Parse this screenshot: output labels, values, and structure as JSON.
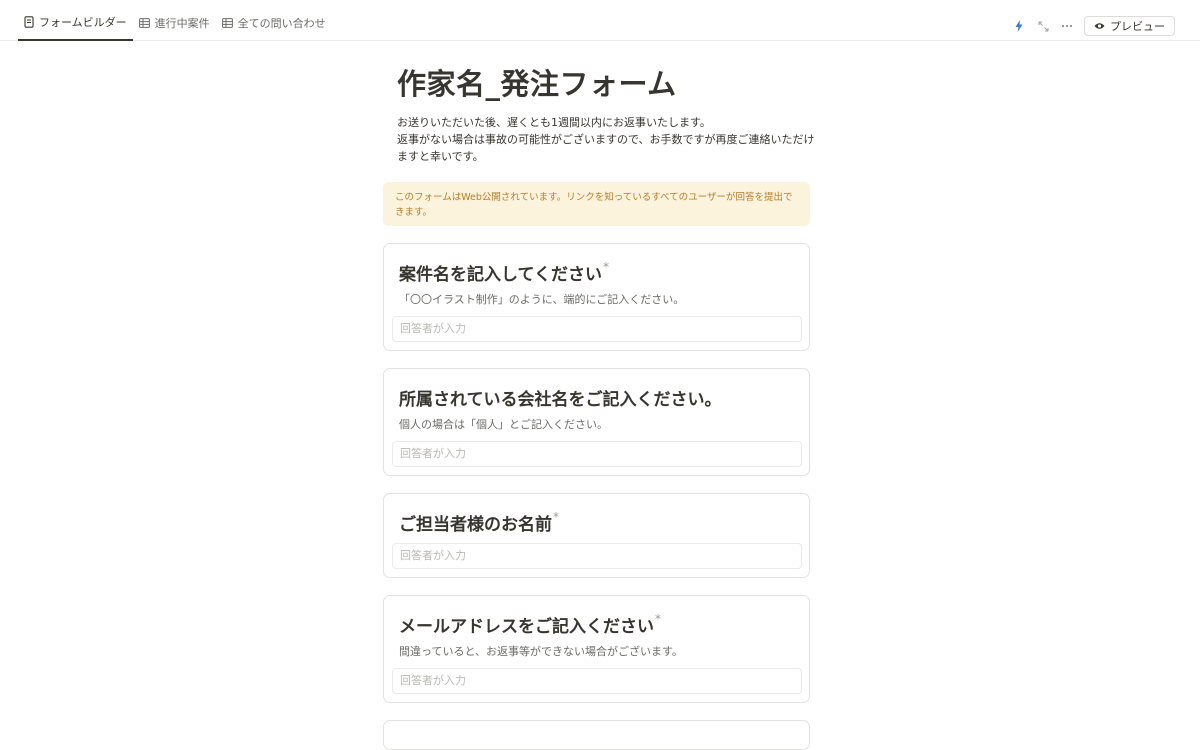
{
  "tabs": [
    {
      "label": "フォームビルダー",
      "active": true
    },
    {
      "label": "進行中案件",
      "active": false
    },
    {
      "label": "全ての問い合わせ",
      "active": false
    }
  ],
  "toolbar": {
    "preview_label": "プレビュー",
    "icons": [
      "lightning-icon",
      "expand-icon",
      "more-icon",
      "eye-icon"
    ]
  },
  "form": {
    "title": "作家名_発注フォーム",
    "description_lines": [
      "お送りいただいた後、遅くとも1週間以内にお返事いたします。",
      "返事がない場合は事故の可能性がございますので、お手数ですが再度ご連絡いただけますと幸いです。"
    ],
    "notice": "このフォームはWeb公開されています。リンクを知っているすべてのユーザーが回答を提出できます。",
    "questions": [
      {
        "title": "案件名を記入してください",
        "required": true,
        "help": "「〇〇イラスト制作」のように、端的にご記入ください。",
        "placeholder": "回答者が入力"
      },
      {
        "title": "所属されている会社名をご記入ください。",
        "required": false,
        "help": "個人の場合は「個人」とご記入ください。",
        "placeholder": "回答者が入力"
      },
      {
        "title": "ご担当者様のお名前",
        "required": true,
        "help": "",
        "placeholder": "回答者が入力"
      },
      {
        "title": "メールアドレスをご記入ください",
        "required": true,
        "help": "間違っていると、お返事等ができない場合がございます。",
        "placeholder": "回答者が入力"
      }
    ]
  },
  "colors": {
    "text": "#37352f",
    "muted": "#6b6b68",
    "notice_bg": "#fbf3db",
    "notice_text": "#b87c2e",
    "border": "#e3e2e0"
  }
}
